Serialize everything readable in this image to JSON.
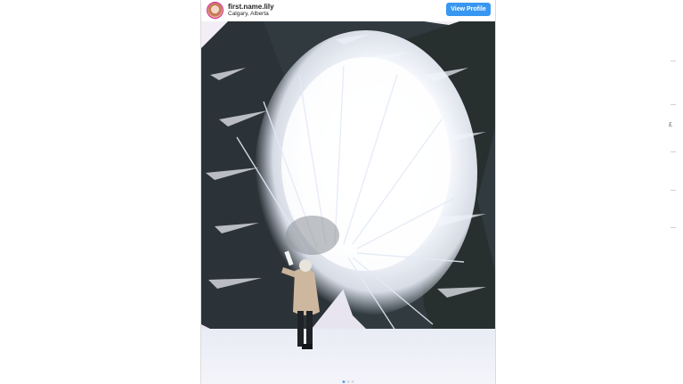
{
  "post": {
    "username": "first.name.lily",
    "location": "Calgary, Alberta",
    "view_profile_label": "View Profile"
  },
  "carousel": {
    "slide_count": 3,
    "active_index": 0
  },
  "side_glyph": "£",
  "colors": {
    "button_blue": "#3897f0",
    "text": "#262626",
    "snow": "#f2f4fa",
    "tree": "#2c3338"
  }
}
